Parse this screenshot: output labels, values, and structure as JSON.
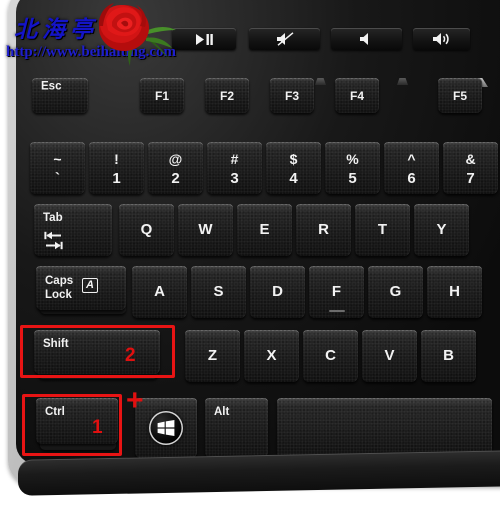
{
  "image": {
    "subject": "computer-keyboard-photo-with-shortcut-annotation",
    "background_color": "#ffffff"
  },
  "watermark": {
    "chinese_text": "北海亭",
    "url_text": "http://www.beihaiting.com",
    "color": "#1e1ecd",
    "decoration": "red-rose"
  },
  "media_strip": {
    "keys": [
      {
        "name": "play-pause",
        "icon": "play-pause-icon"
      },
      {
        "name": "mute",
        "icon": "speaker-mute-icon"
      },
      {
        "name": "volume-down",
        "icon": "speaker-low-icon"
      },
      {
        "name": "volume-up",
        "icon": "speaker-high-icon"
      }
    ]
  },
  "keyboard": {
    "function_row": [
      {
        "label": "Esc"
      },
      {
        "label": "F1"
      },
      {
        "label": "F2"
      },
      {
        "label": "F3"
      },
      {
        "label": "F4"
      },
      {
        "label": "F5"
      }
    ],
    "number_row": [
      {
        "top": "~",
        "bottom": "`"
      },
      {
        "top": "!",
        "bottom": "1"
      },
      {
        "top": "@",
        "bottom": "2"
      },
      {
        "top": "#",
        "bottom": "3"
      },
      {
        "top": "$",
        "bottom": "4"
      },
      {
        "top": "%",
        "bottom": "5"
      },
      {
        "top": "^",
        "bottom": "6"
      },
      {
        "top": "&",
        "bottom": "7"
      }
    ],
    "qwerty_row": {
      "tab_label": "Tab",
      "letters": [
        "Q",
        "W",
        "E",
        "R",
        "T",
        "Y"
      ]
    },
    "home_row": {
      "caps_line1": "Caps",
      "caps_line2": "Lock",
      "caps_indicator": "A",
      "letters": [
        "A",
        "S",
        "D",
        "F",
        "G",
        "H"
      ]
    },
    "shift_row": {
      "shift_label": "Shift",
      "letters": [
        "Z",
        "X",
        "C",
        "V",
        "B"
      ]
    },
    "bottom_row": {
      "ctrl_label": "Ctrl",
      "win_label": "windows-logo",
      "alt_label": "Alt",
      "space_label": ""
    }
  },
  "annotations": {
    "accent_color": "#e01010",
    "ctrl_marker": "1",
    "shift_marker": "2",
    "combo_plus": "+"
  }
}
